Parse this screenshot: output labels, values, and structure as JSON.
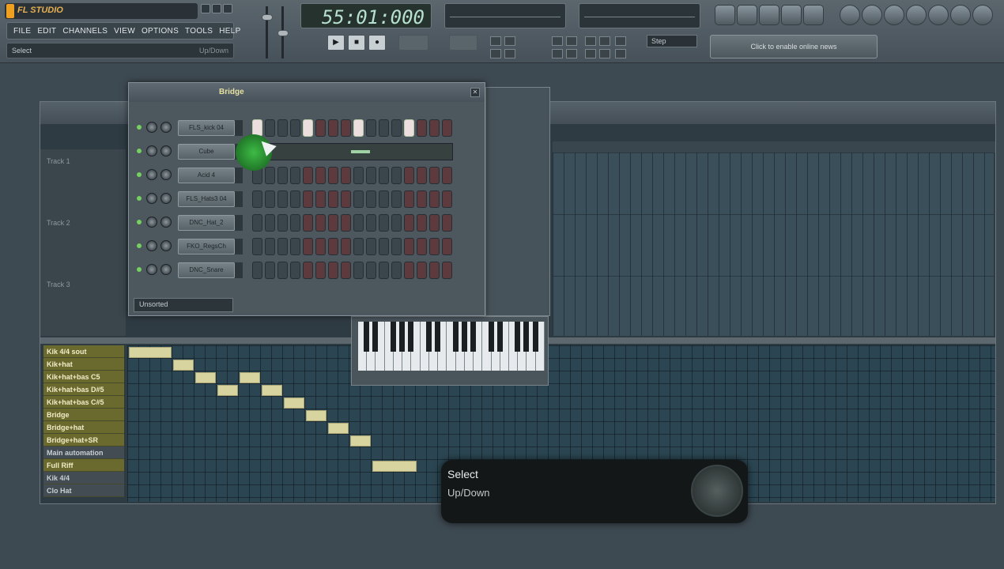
{
  "app": {
    "logo_text": "FL STUDIO"
  },
  "menu": {
    "items": [
      "FILE",
      "EDIT",
      "CHANNELS",
      "VIEW",
      "OPTIONS",
      "TOOLS",
      "HELP"
    ]
  },
  "hint_bar": {
    "left": "Select",
    "right": "Up/Down"
  },
  "transport": {
    "time": "55:01:000",
    "play_icon": "play-icon",
    "stop_icon": "stop-icon",
    "record_icon": "record-icon"
  },
  "snap": {
    "value": "Step"
  },
  "news": {
    "label": "Click to enable online news"
  },
  "step_sequencer": {
    "pattern": "Bridge",
    "filter": "Unsorted",
    "channels": [
      {
        "name": "FLS_kick 04",
        "steps": [
          0,
          0,
          0,
          0,
          0,
          0,
          0,
          0,
          0,
          0,
          0,
          0,
          0,
          0,
          0,
          0
        ],
        "on": [
          0,
          4,
          8,
          12
        ]
      },
      {
        "name": "Cube",
        "steps": [],
        "on": []
      },
      {
        "name": "Acid 4",
        "on": []
      },
      {
        "name": "FLS_Hats3 04",
        "on": []
      },
      {
        "name": "DNC_Hat_2",
        "on": []
      },
      {
        "name": "FKO_RegsCh",
        "on": []
      },
      {
        "name": "DNC_Snare",
        "on": []
      }
    ]
  },
  "playlist": {
    "tracks": [
      "Track 1",
      "Track 2",
      "Track 3"
    ],
    "patterns": [
      {
        "label": "Kik 4/4 sout",
        "active": true
      },
      {
        "label": "Kik+hat",
        "active": true
      },
      {
        "label": "Kik+hat+bas C5",
        "active": true
      },
      {
        "label": "Kik+hat+bas D#5",
        "active": true
      },
      {
        "label": "Kik+hat+bas C#5",
        "active": true
      },
      {
        "label": "Bridge",
        "active": true
      },
      {
        "label": "Bridge+hat",
        "active": true
      },
      {
        "label": "Bridge+hat+SR",
        "active": true
      },
      {
        "label": "Main automation",
        "active": false
      },
      {
        "label": "Full Riff",
        "active": true
      },
      {
        "label": "Kik 4/4",
        "active": false
      },
      {
        "label": "Clo Hat",
        "active": false
      }
    ]
  },
  "popup": {
    "title": "Select",
    "subtitle": "Up/Down"
  }
}
